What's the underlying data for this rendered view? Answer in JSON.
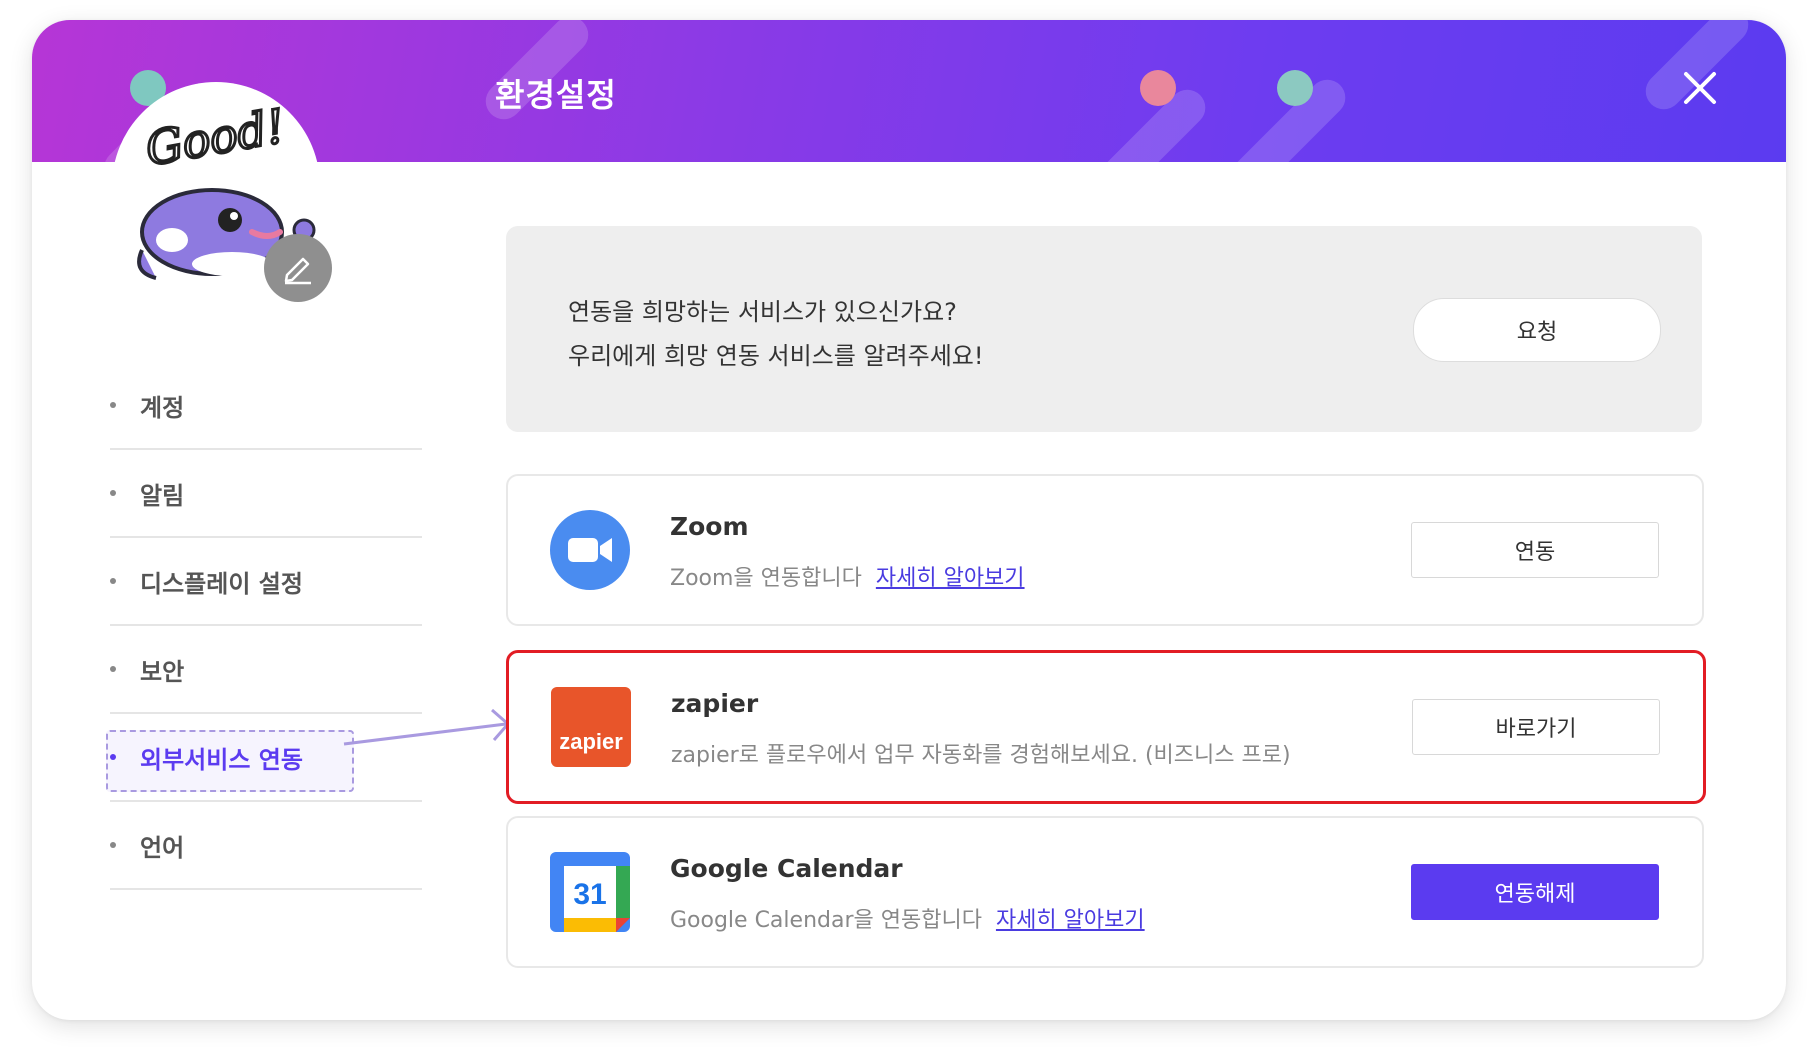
{
  "window": {
    "title": "환경설정",
    "close_icon": "close-icon"
  },
  "profile": {
    "sticker_text": "Good!",
    "edit_icon": "pencil-icon"
  },
  "sidebar": {
    "items": [
      {
        "label": "계정",
        "active": false
      },
      {
        "label": "알림",
        "active": false
      },
      {
        "label": "디스플레이 설정",
        "active": false
      },
      {
        "label": "보안",
        "active": false
      },
      {
        "label": "외부서비스 연동",
        "active": true
      },
      {
        "label": "언어",
        "active": false
      }
    ]
  },
  "request": {
    "line1": "연동을 희망하는 서비스가 있으신가요?",
    "line2": "우리에게 희망 연동 서비스를 알려주세요!",
    "button": "요청"
  },
  "services": [
    {
      "name": "Zoom",
      "description": "Zoom을 연동합니다",
      "link": "자세히 알아보기",
      "button": "연동",
      "icon": "zoom-icon"
    },
    {
      "name": "zapier",
      "description": "zapier로 플로우에서 업무 자동화를 경험해보세요. (비즈니스 프로)",
      "link": "",
      "button": "바로가기",
      "icon": "zapier-icon",
      "logo_text": "zapier"
    },
    {
      "name": "Google Calendar",
      "description": "Google Calendar을 연동합니다",
      "link": "자세히 알아보기",
      "button": "연동해제",
      "icon": "google-calendar-icon",
      "logo_text": "31"
    }
  ],
  "colors": {
    "accent": "#5b3bf0",
    "highlight": "#e21c24",
    "header_start": "#b636d6",
    "header_end": "#5b3bf0"
  }
}
